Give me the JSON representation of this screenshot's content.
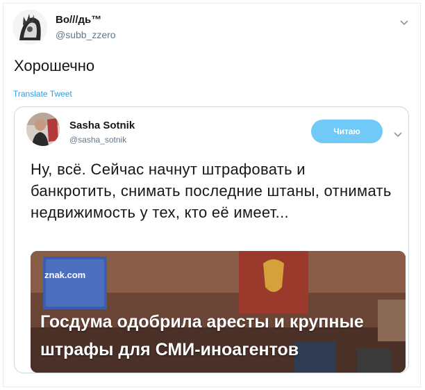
{
  "tweet": {
    "author": {
      "name": "Bo///дь™",
      "handle": "@subb_zzero"
    },
    "text": "Хорошечно",
    "translate_label": "Translate Tweet"
  },
  "quoted_tweet": {
    "author": {
      "name": "Sasha Sotnik",
      "handle": "@sasha_sotnik"
    },
    "follow_label": "Читаю",
    "text": "Ну, всё. Сейчас начнут штрафовать и банкротить, снимать последние штаны, отнимать недвижимость у тех, кто её имеет...",
    "media": {
      "source_logo": "znak.com",
      "headline": "Госдума одобрила аресты и крупные штрафы для СМИ-иноагентов"
    }
  },
  "colors": {
    "link": "#1da1f2",
    "follow_button": "#71c9f8",
    "secondary_text": "#657786"
  }
}
